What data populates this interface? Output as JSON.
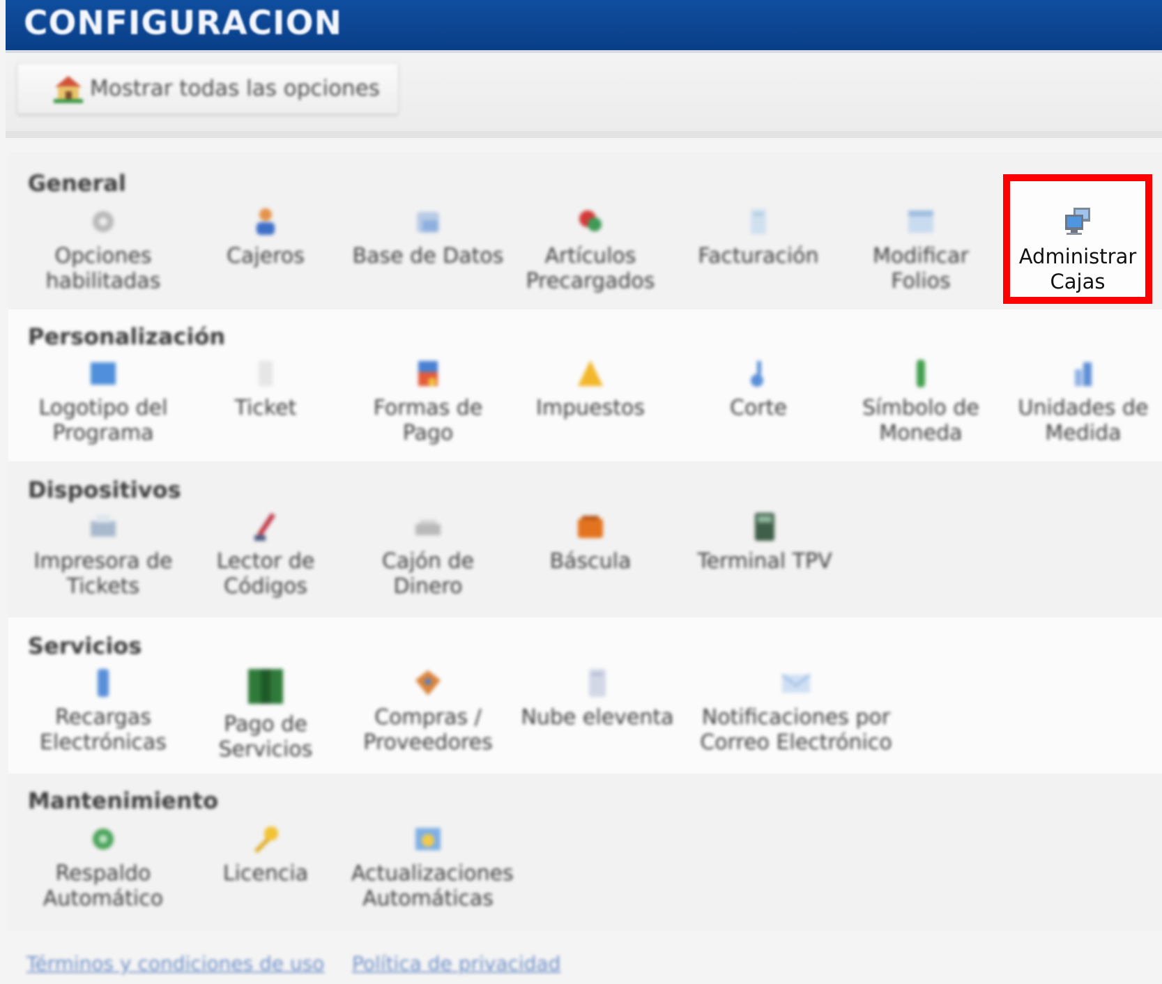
{
  "header": {
    "title": "CONFIGURACION"
  },
  "toolbar": {
    "show_all_label": "Mostrar todas las opciones"
  },
  "sections": {
    "general": {
      "title": "General",
      "items": [
        {
          "label": "Opciones\nhabilitadas",
          "icon": "gear-icon"
        },
        {
          "label": "Cajeros",
          "icon": "cashier-user-icon"
        },
        {
          "label": "Base de Datos",
          "icon": "database-icon"
        },
        {
          "label": "Artículos\nPrecargados",
          "icon": "preloaded-items-icon"
        },
        {
          "label": "Facturación",
          "icon": "invoice-icon"
        },
        {
          "label": "Modificar\nFolios",
          "icon": "folios-icon"
        },
        {
          "label": "Administrar\nCajas",
          "icon": "computers-icon"
        }
      ]
    },
    "personalizacion": {
      "title": "Personalización",
      "items": [
        {
          "label": "Logotipo del\nPrograma",
          "icon": "logo-icon"
        },
        {
          "label": "Ticket",
          "icon": "ticket-icon"
        },
        {
          "label": "Formas de\nPago",
          "icon": "payment-methods-icon"
        },
        {
          "label": "Impuestos",
          "icon": "taxes-icon"
        },
        {
          "label": "Corte",
          "icon": "cut-icon"
        },
        {
          "label": "Símbolo de\nMoneda",
          "icon": "currency-symbol-icon"
        },
        {
          "label": "Unidades de\nMedida",
          "icon": "units-icon"
        }
      ]
    },
    "dispositivos": {
      "title": "Dispositivos",
      "items": [
        {
          "label": "Impresora de\nTickets",
          "icon": "printer-icon"
        },
        {
          "label": "Lector de\nCódigos",
          "icon": "barcode-scanner-icon"
        },
        {
          "label": "Cajón de\nDinero",
          "icon": "cash-drawer-icon"
        },
        {
          "label": "Báscula",
          "icon": "scale-icon"
        },
        {
          "label": "Terminal TPV",
          "icon": "pos-terminal-icon"
        }
      ]
    },
    "servicios": {
      "title": "Servicios",
      "items": [
        {
          "label": "Recargas\nElectrónicas",
          "icon": "phone-recharge-icon"
        },
        {
          "label": "Pago de\nServicios",
          "icon": "service-payment-icon"
        },
        {
          "label": "Compras /\nProveedores",
          "icon": "purchases-icon"
        },
        {
          "label": "Nube eleventa",
          "icon": "cloud-icon"
        },
        {
          "label": "Notificaciones por\nCorreo Electrónico",
          "icon": "email-icon"
        }
      ]
    },
    "mantenimiento": {
      "title": "Mantenimiento",
      "items": [
        {
          "label": "Respaldo\nAutomático",
          "icon": "backup-icon"
        },
        {
          "label": "Licencia",
          "icon": "key-icon"
        },
        {
          "label": "Actualizaciones\nAutomáticas",
          "icon": "updates-icon"
        }
      ]
    }
  },
  "footer": {
    "terms_label": "Términos y condiciones de uso",
    "privacy_label": "Política de privacidad"
  },
  "colors": {
    "header_blue": "#0f4d9e",
    "highlight_red": "#ff0000"
  }
}
